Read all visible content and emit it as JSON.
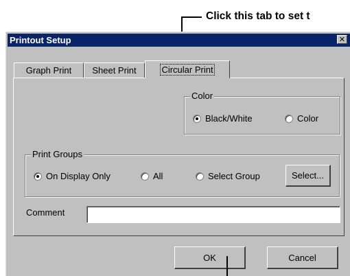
{
  "callout": {
    "text": "Click this tab to set t"
  },
  "window": {
    "title": "Printout Setup",
    "close_glyph": "✕"
  },
  "tabs": [
    {
      "label": "Graph Print",
      "active": false
    },
    {
      "label": "Sheet Print",
      "active": false
    },
    {
      "label": "Circular Print",
      "active": true
    }
  ],
  "color_group": {
    "label": "Color",
    "options": [
      {
        "label": "Black/White",
        "selected": true
      },
      {
        "label": "Color",
        "selected": false
      }
    ]
  },
  "print_groups": {
    "label": "Print Groups",
    "options": [
      {
        "label": "On Display Only",
        "selected": true
      },
      {
        "label": "All",
        "selected": false
      },
      {
        "label": "Select Group",
        "selected": false
      }
    ],
    "select_button": "Select..."
  },
  "comment": {
    "label": "Comment",
    "value": "",
    "placeholder": ""
  },
  "buttons": {
    "ok": "OK",
    "cancel": "Cancel"
  },
  "colors": {
    "title_bar": "#0a246a",
    "face": "#c0c0c0"
  }
}
